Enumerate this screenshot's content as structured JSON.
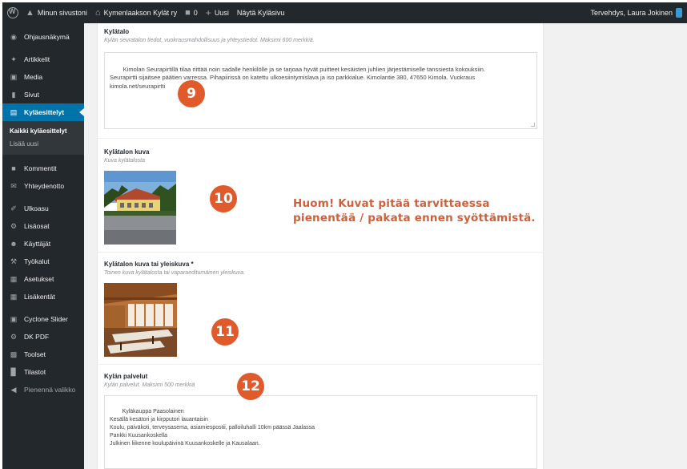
{
  "adminbar": {
    "site_menu": "Minun sivustoni",
    "network": "Kymenlaakson Kylät ry",
    "comments_count": "0",
    "new_label": "Uusi",
    "view_label": "Näytä Kyläsivu",
    "greeting": "Tervehdys, Laura Jokinen"
  },
  "sidebar": {
    "items_top": [
      {
        "label": "Ohjausnäkymä",
        "icon": "dashboard-icon"
      },
      {
        "label": "Artikkelit",
        "icon": "pin-icon"
      },
      {
        "label": "Media",
        "icon": "media-icon"
      },
      {
        "label": "Sivut",
        "icon": "pages-icon"
      },
      {
        "label": "Kyläesittelyt",
        "icon": "document-icon"
      }
    ],
    "submenu": [
      "Kaikki kyläesittelyt",
      "Lisää uusi"
    ],
    "items_mid": [
      {
        "label": "Kommentit",
        "icon": "comment-icon"
      },
      {
        "label": "Yhteydenotto",
        "icon": "mail-icon"
      },
      {
        "label": "Ulkoasu",
        "icon": "brush-icon"
      },
      {
        "label": "Lisäosat",
        "icon": "plugin-icon"
      },
      {
        "label": "Käyttäjät",
        "icon": "users-icon"
      },
      {
        "label": "Työkalut",
        "icon": "wrench-icon"
      },
      {
        "label": "Asetukset",
        "icon": "settings-icon"
      },
      {
        "label": "Lisäkentät",
        "icon": "fields-icon"
      },
      {
        "label": "Cyclone Slider",
        "icon": "slider-icon"
      },
      {
        "label": "DK PDF",
        "icon": "gear-icon"
      },
      {
        "label": "Toolset",
        "icon": "toolset-icon"
      },
      {
        "label": "Tilastot",
        "icon": "stats-icon"
      },
      {
        "label": "Pienennä valikko",
        "icon": "collapse-icon"
      }
    ]
  },
  "fields": {
    "kylatalo": {
      "label": "Kylätalo",
      "desc": "Kylän seuratalon tiedot, vuokrausmahdollisuus ja yhteystiedot. Maksimi 600 merkkiä.",
      "value": "Kimolan Seurapirtillä tilaa riittää noin sadalle henkilölle ja se tarjoaa hyvät puitteet kesäisten juhlien järjestämiselle tanssiesta kokouksiin.\nSeurapirtti sijaitsee päätien varressa. Pihapiirissä on katettu ulkoesiintymislava ja iso parkkialue. Kimolantie 380, 47650 Kimola. Vuokraus\nkimola.net/seurapirtti",
      "badge": "9"
    },
    "kuva": {
      "label": "Kylätalon kuva",
      "desc": "Kuva kylätalosta",
      "badge": "10",
      "notice_line1": "Huom! Kuvat pitää tarvittaessa",
      "notice_line2": "pienentää / pakata ennen syöttämistä."
    },
    "yleiskuva": {
      "label": "Kylätalon kuva tai yleiskuva *",
      "desc": "Toinen kuva kylätalosta tai vaparaeditumäinen yleiskuva.",
      "badge": "11"
    },
    "palvelut": {
      "label": "Kylän palvelut",
      "desc": "Kylän palvelut. Maksimi 500 merkkiä",
      "value": "Kyläkauppa Paasolainen\nKesällä kesätori ja kirpputori lauantaisin\nKoulu, päiväkoti, terveysasema, asiamiespostii, palloiluhalli 10km päässä Jaalassa\nPankki Kuusankoskella\nJulkinen liikenne koulupäivinä Kuusankoskelle ja Kausalaan.",
      "badge": "12"
    }
  },
  "colors": {
    "adminbar": "#23282d",
    "active": "#0073aa",
    "badge": "#e05a2b",
    "notice": "#d0603a"
  }
}
